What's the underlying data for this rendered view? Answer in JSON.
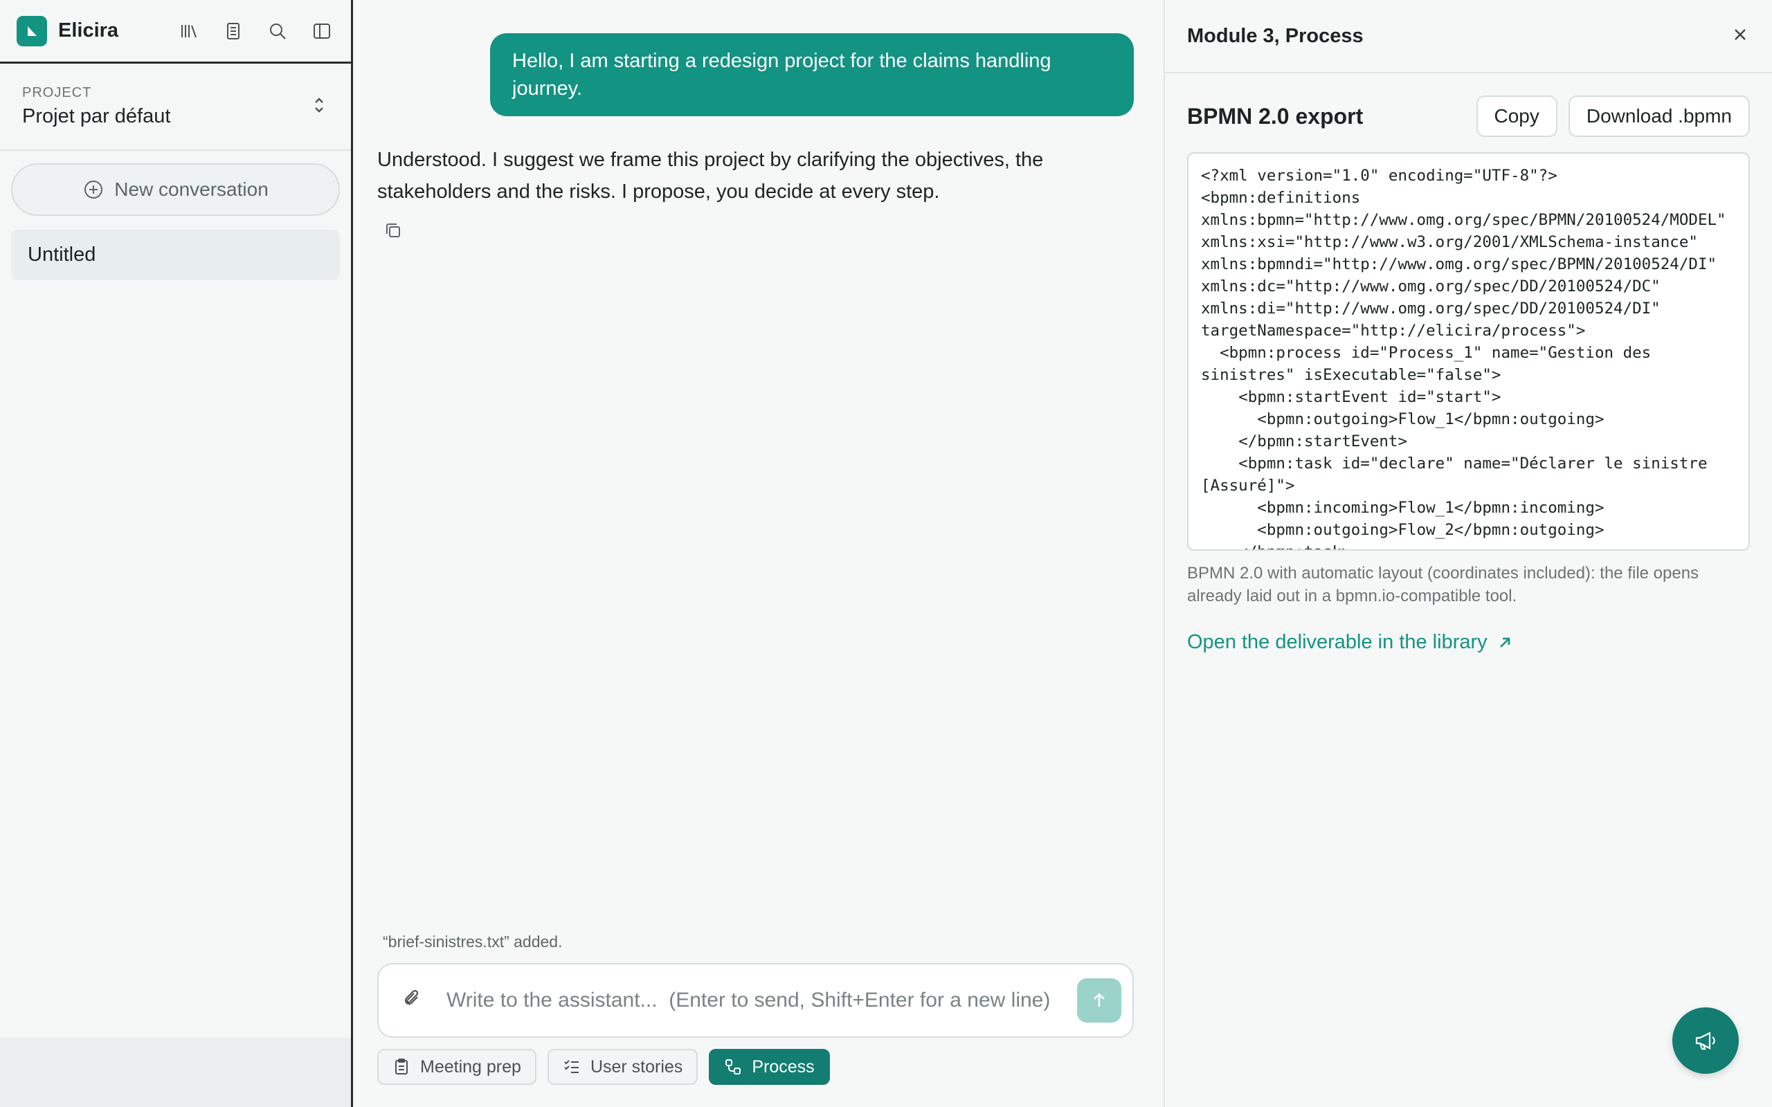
{
  "app": {
    "name": "Elicira"
  },
  "sidebar": {
    "project_label": "PROJECT",
    "project_name": "Projet par défaut",
    "new_conversation": "New conversation",
    "conversations": [
      {
        "label": "Untitled"
      }
    ]
  },
  "chat": {
    "user_message": "Hello, I am starting a redesign project for the claims handling journey.",
    "assistant_message": "Understood. I suggest we frame this project by clarifying the objectives, the stakeholders and the risks. I propose, you decide at every step.",
    "attachment_status": "“brief-sinistres.txt” added.",
    "input_placeholder": "Write to the assistant...  (Enter to send, Shift+Enter for a new line)",
    "chips": [
      {
        "label": "Meeting prep",
        "icon": "clipboard-icon",
        "active": false
      },
      {
        "label": "User stories",
        "icon": "list-check-icon",
        "active": false
      },
      {
        "label": "Process",
        "icon": "flow-icon",
        "active": true
      }
    ]
  },
  "panel": {
    "title": "Module 3, Process",
    "subtitle": "BPMN 2.0 export",
    "copy_label": "Copy",
    "download_label": "Download .bpmn",
    "xml": "<?xml version=\"1.0\" encoding=\"UTF-8\"?>\n<bpmn:definitions\nxmlns:bpmn=\"http://www.omg.org/spec/BPMN/20100524/MODEL\"\nxmlns:xsi=\"http://www.w3.org/2001/XMLSchema-instance\"\nxmlns:bpmndi=\"http://www.omg.org/spec/BPMN/20100524/DI\"\nxmlns:dc=\"http://www.omg.org/spec/DD/20100524/DC\"\nxmlns:di=\"http://www.omg.org/spec/DD/20100524/DI\"\ntargetNamespace=\"http://elicira/process\">\n  <bpmn:process id=\"Process_1\" name=\"Gestion des\nsinistres\" isExecutable=\"false\">\n    <bpmn:startEvent id=\"start\">\n      <bpmn:outgoing>Flow_1</bpmn:outgoing>\n    </bpmn:startEvent>\n    <bpmn:task id=\"declare\" name=\"Déclarer le sinistre\n[Assuré]\">\n      <bpmn:incoming>Flow_1</bpmn:incoming>\n      <bpmn:outgoing>Flow_2</bpmn:outgoing>\n    </bpmn:task>",
    "note": "BPMN 2.0 with automatic layout (coordinates included): the file opens already laid out in a bpmn.io-compatible tool.",
    "library_link": "Open the deliverable in the library"
  },
  "colors": {
    "accent": "#139382",
    "accent_dark": "#127d70",
    "send_disabled": "#9bd3cb"
  }
}
